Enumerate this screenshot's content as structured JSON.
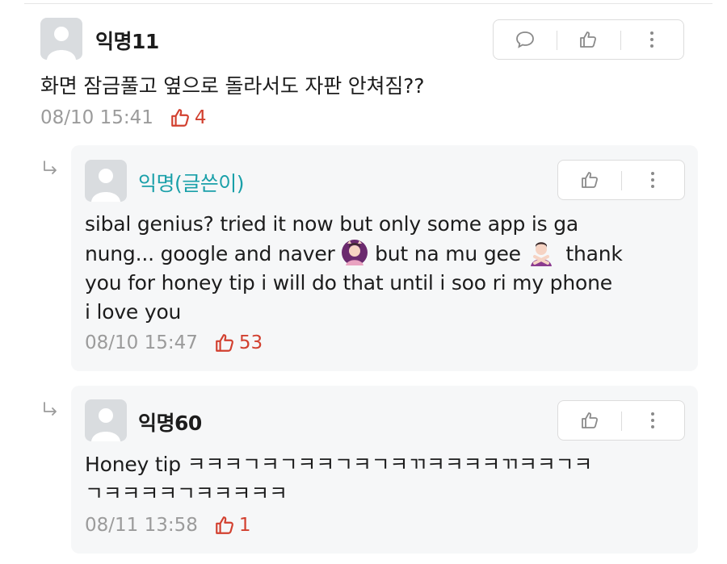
{
  "comments": [
    {
      "nickname": "익명11",
      "body": "화면 잠금풀고 옆으로 돌라서도 자판 안쳐짐??",
      "timestamp": "08/10 15:41",
      "likes": "4"
    },
    {
      "nickname": "익명(글쓴이)",
      "body_lines": [
        "sibal genius? tried it now but only some app is ga",
        "nung... google and naver",
        "but na mu gee",
        "thank",
        "you for honey tip i will do that until i soo ri my phone",
        "i love you"
      ],
      "timestamp": "08/10 15:47",
      "likes": "53"
    },
    {
      "nickname": "익명60",
      "body_lines": [
        "Honey tip ㅋㅋㅋㄱㅋㄱㅋㅋㄱㅋㄱㅋㄲㅋㅋㅋㅋㄲㅋㅋㄱㅋ",
        "ㄱㅋㅋㅋㅋㄱㅋㅋㅋㅋㅋ"
      ],
      "timestamp": "08/11 13:58",
      "likes": "1"
    }
  ],
  "icons": {
    "comment": "speech-bubble-icon",
    "like": "thumbs-up-icon",
    "more": "vertical-dots-icon",
    "reply": "reply-arrow-icon"
  },
  "colors": {
    "vote": "#d2402f",
    "author": "#1aa0a9",
    "meta": "#9b9b9b"
  }
}
